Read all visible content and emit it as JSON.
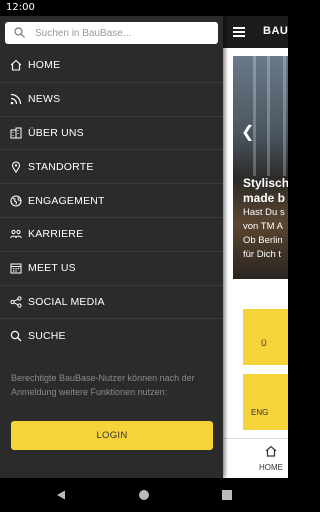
{
  "status_bar": {
    "time": "12:00"
  },
  "search": {
    "placeholder": "Suchen in BauBase..."
  },
  "menu": {
    "items": [
      {
        "label": "HOME",
        "icon": "home-icon"
      },
      {
        "label": "NEWS",
        "icon": "rss-icon"
      },
      {
        "label": "ÜBER UNS",
        "icon": "building-icon"
      },
      {
        "label": "STANDORTE",
        "icon": "location-pin-icon"
      },
      {
        "label": "ENGAGEMENT",
        "icon": "globe-icon"
      },
      {
        "label": "KARRIERE",
        "icon": "people-icon"
      },
      {
        "label": "MEET US",
        "icon": "calendar-icon"
      },
      {
        "label": "SOCIAL MEDIA",
        "icon": "share-icon"
      },
      {
        "label": "SUCHE",
        "icon": "search-icon"
      }
    ]
  },
  "login_note": "Berechtigte BauBase-Nutzer können nach der Anmeldung weitere Funktionen nutzen:",
  "login_button": "LOGIN",
  "app": {
    "title": "BAU",
    "hero": {
      "headline_1": "Stylisch",
      "headline_2": "made b",
      "body_1": "Hast Du s",
      "body_2": "von TM A",
      "body_3": "Ob Berlin",
      "body_4": "für Dich t"
    },
    "tile_1": "Ü",
    "tile_2": "ENG",
    "bottom_nav_home": "HOME"
  },
  "colors": {
    "accent": "#f5d33a",
    "drawer_bg": "#2b2b2b",
    "header_bg": "#1c1c1c"
  }
}
